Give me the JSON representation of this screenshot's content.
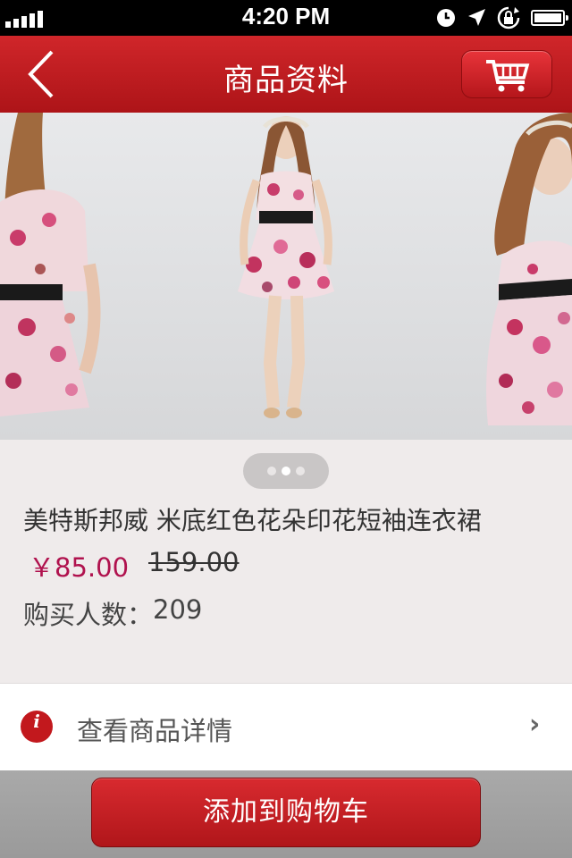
{
  "status_bar": {
    "time": "4:20 PM",
    "icons": [
      "signal-bars-icon",
      "clock-icon",
      "location-arrow-icon",
      "rotation-lock-icon",
      "battery-icon"
    ]
  },
  "nav": {
    "title": "商品资料",
    "back_icon": "chevron-left-icon",
    "cart_icon": "shopping-cart-icon"
  },
  "carousel": {
    "pages": 3,
    "active_page": 1
  },
  "product": {
    "name": "美特斯邦威 米底红色花朵印花短袖连衣裙",
    "price": "￥85.00",
    "original_price": "159.00",
    "buyers_label": "购买人数：",
    "buyers_count": "209"
  },
  "detail_link": {
    "icon": "info-icon",
    "icon_glyph": "i",
    "label": "查看商品详情",
    "chevron": "›"
  },
  "actions": {
    "add_to_cart": "添加到购物车"
  },
  "colors": {
    "brand_red": "#c2181d",
    "price_color": "#b0124e"
  }
}
